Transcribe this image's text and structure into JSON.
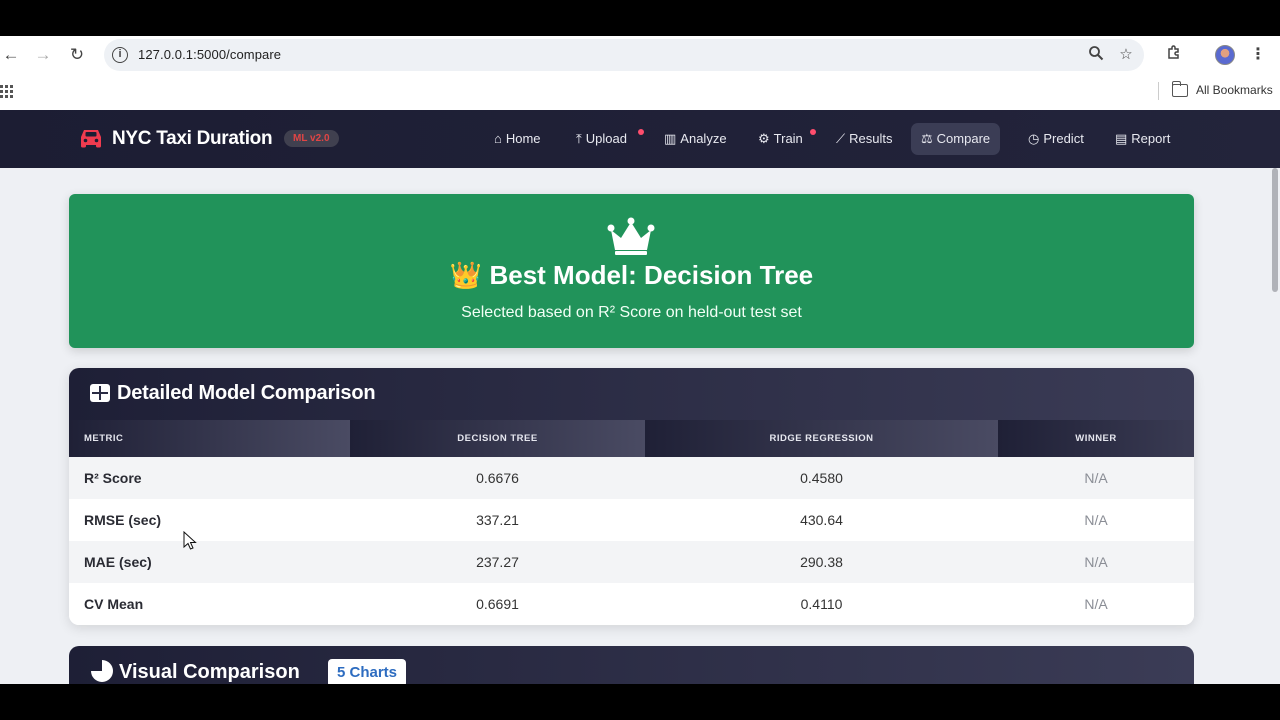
{
  "browser": {
    "url": "127.0.0.1:5000/compare",
    "bookmarks_label": "All Bookmarks"
  },
  "app": {
    "brand_title": "NYC Taxi Duration",
    "brand_badge": "ML v2.0",
    "nav": [
      {
        "label": "Home",
        "icon": "home-icon"
      },
      {
        "label": "Upload",
        "icon": "upload-icon",
        "dot": true
      },
      {
        "label": "Analyze",
        "icon": "chart-bar-icon"
      },
      {
        "label": "Train",
        "icon": "robot-icon",
        "dot": true
      },
      {
        "label": "Results",
        "icon": "line-chart-icon"
      },
      {
        "label": "Compare",
        "icon": "balance-scale-icon",
        "active": true
      },
      {
        "label": "Predict",
        "icon": "clock-icon"
      },
      {
        "label": "Report",
        "icon": "document-icon"
      }
    ],
    "colors": {
      "navbar": "#1c1d33",
      "hero": "#21935a",
      "accent_red": "#e04545",
      "badge_blue": "#2d6cc0"
    }
  },
  "hero": {
    "title": "👑 Best Model: Decision Tree",
    "subtitle": "Selected based on R² Score on held-out test set"
  },
  "comparison": {
    "title": "Detailed Model Comparison",
    "columns": [
      "Metric",
      "Decision Tree",
      "Ridge Regression",
      "Winner"
    ],
    "rows": [
      {
        "metric": "R² Score",
        "decision_tree": "0.6676",
        "ridge": "0.4580",
        "winner": "N/A"
      },
      {
        "metric": "RMSE (sec)",
        "decision_tree": "337.21",
        "ridge": "430.64",
        "winner": "N/A"
      },
      {
        "metric": "MAE (sec)",
        "decision_tree": "237.27",
        "ridge": "290.38",
        "winner": "N/A"
      },
      {
        "metric": "CV Mean",
        "decision_tree": "0.6691",
        "ridge": "0.4110",
        "winner": "N/A"
      }
    ]
  },
  "visual": {
    "title": "Visual Comparison",
    "badge": "5 Charts"
  }
}
